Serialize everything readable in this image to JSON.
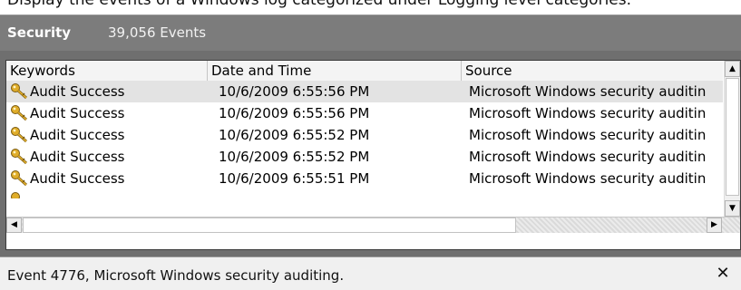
{
  "caption": "Display the events of a Windows log categorized under Logging level categories.",
  "header": {
    "title": "Security",
    "count": "39,056 Events"
  },
  "columns": [
    "Keywords",
    "Date and Time",
    "Source"
  ],
  "rows": [
    {
      "keywords": "Audit Success",
      "datetime": "10/6/2009 6:55:56 PM",
      "source": "Microsoft Windows security auditing."
    },
    {
      "keywords": "Audit Success",
      "datetime": "10/6/2009 6:55:56 PM",
      "source": "Microsoft Windows security auditing."
    },
    {
      "keywords": "Audit Success",
      "datetime": "10/6/2009 6:55:52 PM",
      "source": "Microsoft Windows security auditing."
    },
    {
      "keywords": "Audit Success",
      "datetime": "10/6/2009 6:55:52 PM",
      "source": "Microsoft Windows security auditing."
    },
    {
      "keywords": "Audit Success",
      "datetime": "10/6/2009 6:55:51 PM",
      "source": "Microsoft Windows security auditing."
    }
  ],
  "selected_row": 0,
  "status": {
    "text": "Event 4776, Microsoft Windows security auditing.",
    "close_glyph": "✕"
  },
  "icons": {
    "row_icon": "key-icon",
    "scroll_up": "arrow-up-icon",
    "scroll_down": "arrow-down-icon",
    "scroll_left": "arrow-left-icon",
    "scroll_right": "arrow-right-icon"
  },
  "colors": {
    "header_bg": "#7c7c7c",
    "selected_row_bg": "#e3e3e3",
    "key_icon": "#d9a21c"
  }
}
